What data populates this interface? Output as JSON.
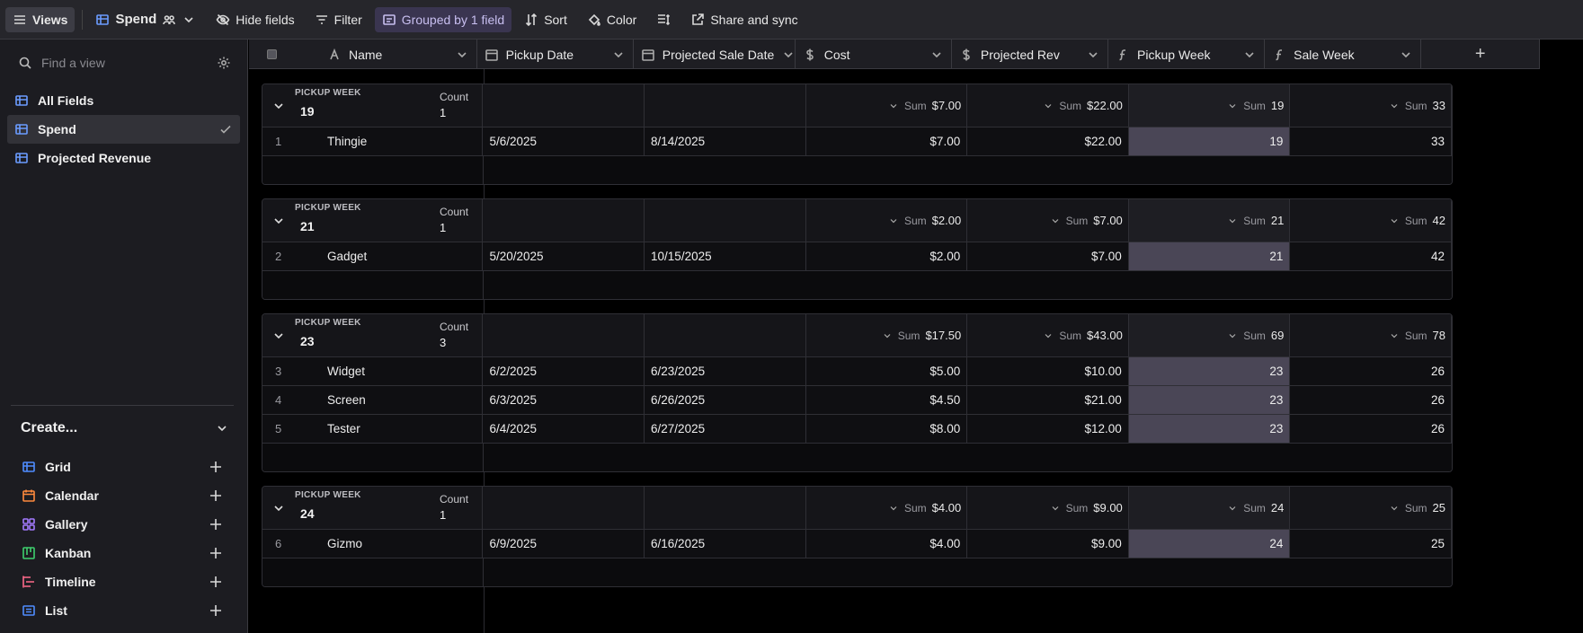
{
  "toolbar": {
    "views_label": "Views",
    "view_name": "Spend",
    "hide_fields": "Hide fields",
    "filter": "Filter",
    "grouped": "Grouped by 1 field",
    "sort": "Sort",
    "color": "Color",
    "share": "Share and sync"
  },
  "sidebar": {
    "search_placeholder": "Find a view",
    "views": [
      {
        "label": "All Fields"
      },
      {
        "label": "Spend"
      },
      {
        "label": "Projected Revenue"
      }
    ],
    "create_title": "Create...",
    "create_items": [
      {
        "label": "Grid",
        "icon": "grid-icon",
        "color": "#4f8cff"
      },
      {
        "label": "Calendar",
        "icon": "calendar-icon",
        "color": "#ff8a3d"
      },
      {
        "label": "Gallery",
        "icon": "gallery-icon",
        "color": "#a37bff"
      },
      {
        "label": "Kanban",
        "icon": "kanban-icon",
        "color": "#3ecf6e"
      },
      {
        "label": "Timeline",
        "icon": "timeline-icon",
        "color": "#ff6b8b"
      },
      {
        "label": "List",
        "icon": "list-icon",
        "color": "#4f8cff"
      }
    ]
  },
  "columns": [
    {
      "label": "Name",
      "icon": "text-icon"
    },
    {
      "label": "Pickup Date",
      "icon": "calendar-icon"
    },
    {
      "label": "Projected Sale Date",
      "icon": "calendar-icon"
    },
    {
      "label": "Cost",
      "icon": "dollar-icon"
    },
    {
      "label": "Projected Rev",
      "icon": "dollar-icon"
    },
    {
      "label": "Pickup Week",
      "icon": "formula-icon"
    },
    {
      "label": "Sale Week",
      "icon": "formula-icon"
    }
  ],
  "add_field": "+",
  "group_label": "PICKUP WEEK",
  "count_label": "Count",
  "sum_label": "Sum",
  "groups": [
    {
      "value": "19",
      "count": "1",
      "sums": {
        "cost": "$7.00",
        "rev": "$22.00",
        "pickup": "19",
        "sale": "33"
      },
      "rows": [
        {
          "num": "1",
          "name": "Thingie",
          "pickup_date": "5/6/2025",
          "sale_date": "8/14/2025",
          "cost": "$7.00",
          "rev": "$22.00",
          "pickup_week": "19",
          "sale_week": "33"
        }
      ]
    },
    {
      "value": "21",
      "count": "1",
      "sums": {
        "cost": "$2.00",
        "rev": "$7.00",
        "pickup": "21",
        "sale": "42"
      },
      "rows": [
        {
          "num": "2",
          "name": "Gadget",
          "pickup_date": "5/20/2025",
          "sale_date": "10/15/2025",
          "cost": "$2.00",
          "rev": "$7.00",
          "pickup_week": "21",
          "sale_week": "42"
        }
      ]
    },
    {
      "value": "23",
      "count": "3",
      "sums": {
        "cost": "$17.50",
        "rev": "$43.00",
        "pickup": "69",
        "sale": "78"
      },
      "rows": [
        {
          "num": "3",
          "name": "Widget",
          "pickup_date": "6/2/2025",
          "sale_date": "6/23/2025",
          "cost": "$5.00",
          "rev": "$10.00",
          "pickup_week": "23",
          "sale_week": "26"
        },
        {
          "num": "4",
          "name": "Screen",
          "pickup_date": "6/3/2025",
          "sale_date": "6/26/2025",
          "cost": "$4.50",
          "rev": "$21.00",
          "pickup_week": "23",
          "sale_week": "26"
        },
        {
          "num": "5",
          "name": "Tester",
          "pickup_date": "6/4/2025",
          "sale_date": "6/27/2025",
          "cost": "$8.00",
          "rev": "$12.00",
          "pickup_week": "23",
          "sale_week": "26"
        }
      ]
    },
    {
      "value": "24",
      "count": "1",
      "sums": {
        "cost": "$4.00",
        "rev": "$9.00",
        "pickup": "24",
        "sale": "25"
      },
      "rows": [
        {
          "num": "6",
          "name": "Gizmo",
          "pickup_date": "6/9/2025",
          "sale_date": "6/16/2025",
          "cost": "$4.00",
          "rev": "$9.00",
          "pickup_week": "24",
          "sale_week": "25"
        }
      ]
    }
  ]
}
